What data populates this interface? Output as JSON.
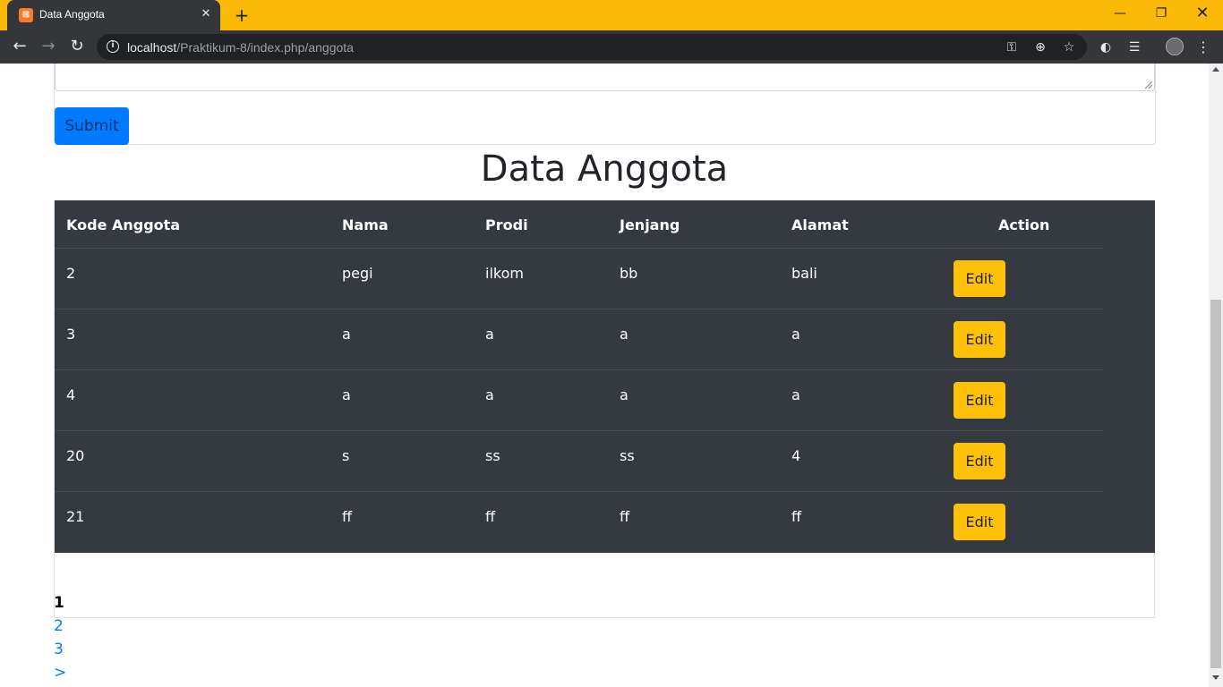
{
  "browser": {
    "tab_title": "Data Anggota",
    "new_tab_label": "+",
    "url_host": "localhost",
    "url_path": "/Praktikum-8/index.php/anggota"
  },
  "form": {
    "submit_label": "Submit"
  },
  "page": {
    "title": "Data Anggota"
  },
  "table": {
    "headers": [
      "Kode Anggota",
      "Nama",
      "Prodi",
      "Jenjang",
      "Alamat",
      "Action"
    ],
    "rows": [
      {
        "kode": "2",
        "nama": "pegi",
        "prodi": "ilkom",
        "jenjang": "bb",
        "alamat": "bali",
        "action": "Edit"
      },
      {
        "kode": "3",
        "nama": "a",
        "prodi": "a",
        "jenjang": "a",
        "alamat": "a",
        "action": "Edit"
      },
      {
        "kode": "4",
        "nama": "a",
        "prodi": "a",
        "jenjang": "a",
        "alamat": "a",
        "action": "Edit"
      },
      {
        "kode": "20",
        "nama": "s",
        "prodi": "ss",
        "jenjang": "ss",
        "alamat": "4",
        "action": "Edit"
      },
      {
        "kode": "21",
        "nama": "ff",
        "prodi": "ff",
        "jenjang": "ff",
        "alamat": "ff",
        "action": "Edit"
      }
    ]
  },
  "pagination": {
    "current": "1",
    "links": [
      "2",
      "3",
      ">"
    ]
  },
  "colors": {
    "tab_bar": "#fbb908",
    "primary": "#007bff",
    "warning": "#ffc107",
    "table_dark": "#343a40"
  }
}
